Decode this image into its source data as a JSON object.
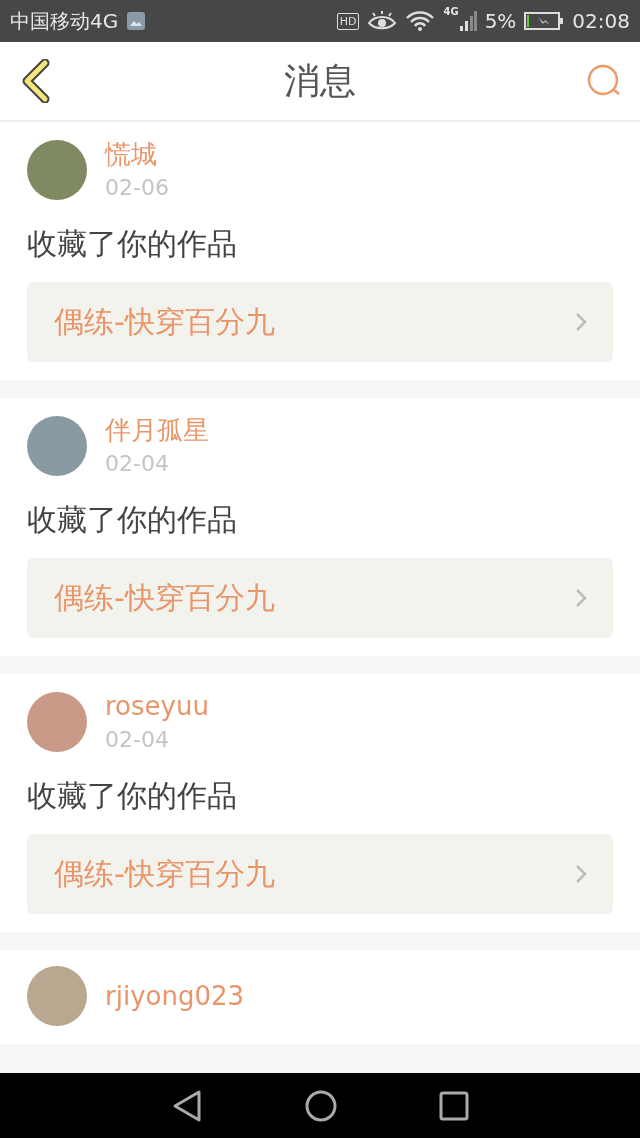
{
  "status_bar": {
    "carrier": "中国移动4G",
    "hd": "HD",
    "network": "4G",
    "battery": "5%",
    "time": "02:08"
  },
  "header": {
    "title": "消息"
  },
  "messages": [
    {
      "name": "慌城",
      "date": "02-06",
      "action": "收藏了你的作品",
      "work": "偶练-快穿百分九"
    },
    {
      "name": "伴月孤星",
      "date": "02-04",
      "action": "收藏了你的作品",
      "work": "偶练-快穿百分九"
    },
    {
      "name": "roseyuu",
      "date": "02-04",
      "action": "收藏了你的作品",
      "work": "偶练-快穿百分九"
    },
    {
      "name": "rjiyong023"
    }
  ]
}
